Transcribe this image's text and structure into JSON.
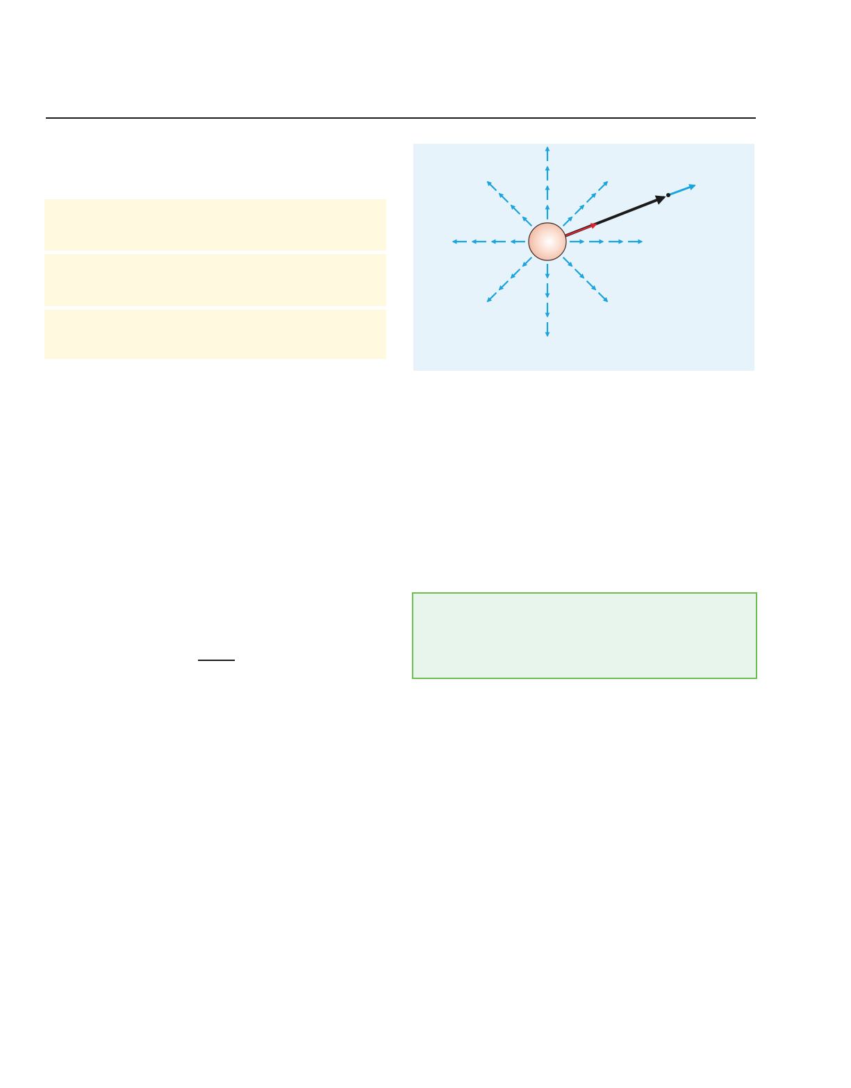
{
  "colors": {
    "rule": "#1a1a1a",
    "highlight_box": "#fef9df",
    "figure_background": "#e6f3fb",
    "field_arrows": "#1aa3dc",
    "charge_fill": "#f6c8b4",
    "position_vector": "#1a1a1a",
    "unit_vector": "#d8262e",
    "note_box_fill": "#e8f5ec",
    "note_box_border": "#6cbc4e"
  },
  "figure": {
    "icon": "radial-electric-field-diagram",
    "field_line_count": 8
  }
}
